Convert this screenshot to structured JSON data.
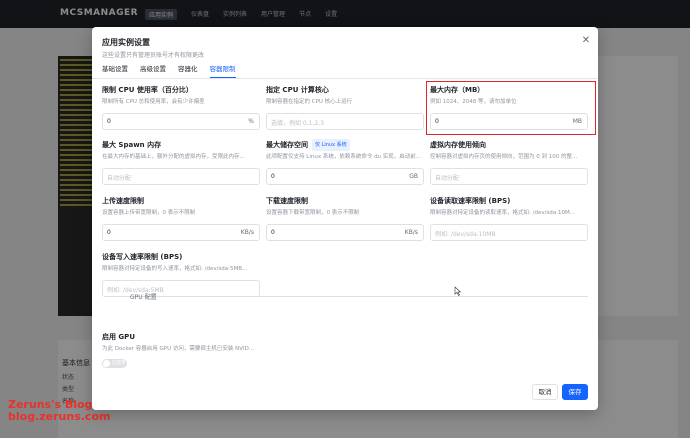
{
  "background": {
    "brand": "MCSMANAGER",
    "nav": [
      "应用实例",
      "仪表盘",
      "实例列表",
      "用户管理",
      "节点",
      "设置"
    ],
    "lower_title": "基本信息",
    "lower_cells": [
      "状态",
      "类型",
      "名称"
    ]
  },
  "watermark": {
    "line1": "Zeruns's Blog",
    "line2": "blog.zeruns.com"
  },
  "modal": {
    "title": "应用实例设置",
    "subtitle": "这些设置只有管理员账号才有权限更改",
    "close_icon": "✕",
    "tabs": [
      "基础设置",
      "高级设置",
      "容器化",
      "容器限制"
    ],
    "active_tab": 3
  },
  "fields": {
    "cpu_usage": {
      "label": "限制 CPU 使用率（百分比）",
      "desc": "限制所有 CPU 总和使用率，会有少许偏差",
      "value": "0",
      "unit": "%"
    },
    "cpu_cores": {
      "label": "指定 CPU 计算核心",
      "desc": "限制容器在指定的 CPU 核心上运行",
      "placeholder": "选填，例如 0,1,2,3"
    },
    "max_memory": {
      "label": "最大内存（MB）",
      "desc": "例如 1024、2048 等，请勿加单位",
      "value": "0",
      "unit": "MB"
    },
    "max_spawn": {
      "label": "最大 Spawn 内存",
      "desc": "在最大内存的基础上，额外分配的虚拟内存，受限此内存...",
      "placeholder": "自动分配"
    },
    "max_storage": {
      "label": "最大储存空间",
      "badge": "仅 Linux 系统",
      "desc": "此项配置仅支持 Linux 系统，依赖系统命令 du 实现，启动前...",
      "value": "0",
      "unit": "GB"
    },
    "swap_tendency": {
      "label": "虚拟内存使用倾向",
      "desc": "控制容器对虚拟内存页的使用倾向，范围为 0 到 100 的整...",
      "placeholder": "自动分配"
    },
    "upload_limit": {
      "label": "上传速度限制",
      "desc": "设置容器上传带宽限制，0 表示不限制",
      "value": "0",
      "unit": "KB/s"
    },
    "download_limit": {
      "label": "下载速度限制",
      "desc": "设置容器下载带宽限制，0 表示不限制",
      "value": "0",
      "unit": "KB/s"
    },
    "read_limit": {
      "label": "设备读取速率限制 (BPS)",
      "desc": "限制容器对特定设备的读取速率，格式如: /dev/sda:10M...",
      "placeholder": "例如: /dev/sda:10MB"
    },
    "write_limit": {
      "label": "设备写入速率限制 (BPS)",
      "desc": "限制容器对特定设备的写入速率，格式如: /dev/sda:5MB...",
      "placeholder": "例如: /dev/sda:5MB"
    }
  },
  "gpu": {
    "section_title": "GPU 配置",
    "label": "启用 GPU",
    "desc": "为此 Docker 容器启用 GPU 访问，需要宿主机已安装 NVID...",
    "toggle_label": "已禁用"
  },
  "footer": {
    "cancel": "取消",
    "save": "保存"
  }
}
